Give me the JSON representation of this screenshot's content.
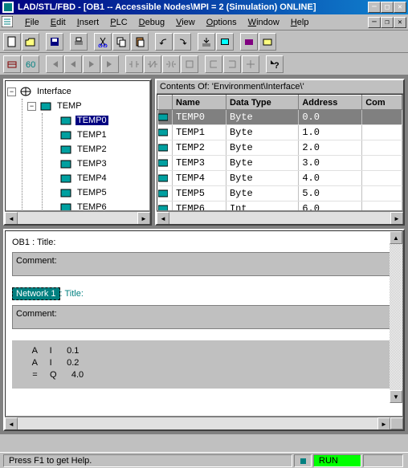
{
  "titlebar": {
    "app": "LAD/STL/FBD",
    "doc": "[OB1 -- Accessible Nodes\\MPI =  2 (Simulation) ONLINE]"
  },
  "menu": {
    "file": "File",
    "edit": "Edit",
    "insert": "Insert",
    "plc": "PLC",
    "debug": "Debug",
    "view": "View",
    "options": "Options",
    "window": "Window",
    "help": "Help"
  },
  "tree": {
    "root": "Interface",
    "temp": "TEMP",
    "items": [
      "TEMP0",
      "TEMP1",
      "TEMP2",
      "TEMP3",
      "TEMP4",
      "TEMP5",
      "TEMP6"
    ],
    "selected_index": 0
  },
  "grid": {
    "header": "Contents Of: 'Environment\\Interface\\'",
    "cols": [
      "Name",
      "Data Type",
      "Address",
      "Com"
    ],
    "rows": [
      {
        "name": "TEMP0",
        "type": "Byte",
        "addr": "0.0"
      },
      {
        "name": "TEMP1",
        "type": "Byte",
        "addr": "1.0"
      },
      {
        "name": "TEMP2",
        "type": "Byte",
        "addr": "2.0"
      },
      {
        "name": "TEMP3",
        "type": "Byte",
        "addr": "3.0"
      },
      {
        "name": "TEMP4",
        "type": "Byte",
        "addr": "4.0"
      },
      {
        "name": "TEMP5",
        "type": "Byte",
        "addr": "5.0"
      },
      {
        "name": "TEMP6",
        "type": "Int",
        "addr": "6.0"
      }
    ],
    "selected_index": 0
  },
  "code": {
    "block_title": "OB1 : Title:",
    "comment_label": "Comment:",
    "network_label": "Network 1",
    "network_title": ": Title:",
    "lines": [
      "     A     I      0.1",
      "     A     I      0.2",
      "     =     Q      4.0"
    ]
  },
  "status": {
    "help": "Press F1 to get Help.",
    "run": "RUN"
  }
}
